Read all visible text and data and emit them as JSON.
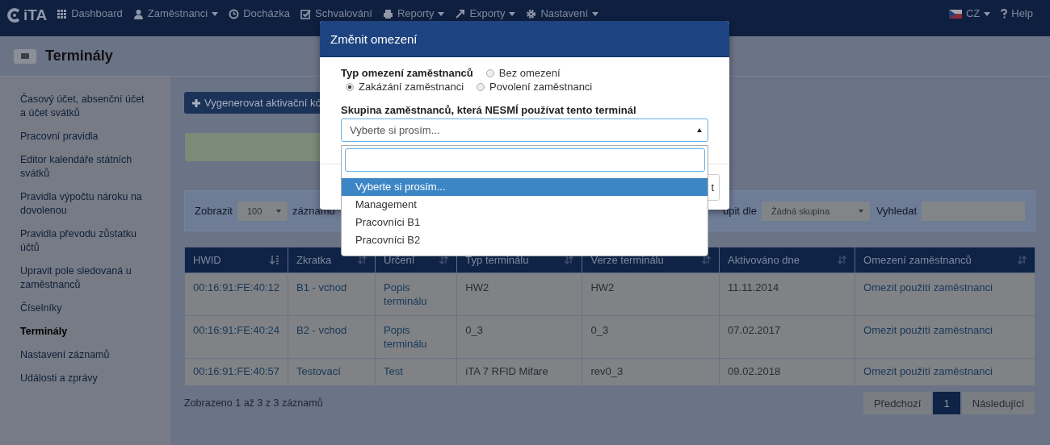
{
  "nav": {
    "logo": "iTA",
    "items": [
      {
        "label": "Dashboard",
        "caret": false
      },
      {
        "label": "Zaměstnanci",
        "caret": true
      },
      {
        "label": "Docházka",
        "caret": false
      },
      {
        "label": "Schvalování",
        "caret": false
      },
      {
        "label": "Reporty",
        "caret": true
      },
      {
        "label": "Exporty",
        "caret": true
      },
      {
        "label": "Nastavení",
        "caret": true
      }
    ],
    "language": "CZ",
    "help": "Help"
  },
  "page_title": "Terminály",
  "sidebar": {
    "items": [
      {
        "label": "Časový účet, absenční účet a účet svátků",
        "selected": false
      },
      {
        "label": "Pracovní pravidla",
        "selected": false
      },
      {
        "label": "Editor kalendáře státních svátků",
        "selected": false
      },
      {
        "label": "Pravidla výpočtu nároku na dovolenou",
        "selected": false
      },
      {
        "label": "Pravidla převodu zůstatku účtů",
        "selected": false
      },
      {
        "label": "Upravit pole sledovaná u zaměstnanců",
        "selected": false
      },
      {
        "label": "Číselníky",
        "selected": false
      },
      {
        "label": "Terminály",
        "selected": true
      },
      {
        "label": "Nastavení záznamů",
        "selected": false
      },
      {
        "label": "Události a zprávy",
        "selected": false
      }
    ]
  },
  "generate_button": "Vygenerovat aktivační kó",
  "filters": {
    "show_label": "Zobrazit",
    "page_size": "100",
    "records_label": "záznamu",
    "group_label": "upit dle",
    "group_value": "Žádná skupina",
    "search_label": "Vyhledat"
  },
  "table": {
    "columns": [
      {
        "label": "HWID",
        "sorted": true,
        "link": true
      },
      {
        "label": "Zkratka",
        "sorted": false,
        "link": true
      },
      {
        "label": "Určení",
        "sorted": false,
        "link": true
      },
      {
        "label": "Typ terminálu",
        "sorted": false,
        "link": false
      },
      {
        "label": "Verze terminálu",
        "sorted": false,
        "link": false
      },
      {
        "label": "Aktivováno dne",
        "sorted": false,
        "link": false
      },
      {
        "label": "Omezení zaměstnanců",
        "sorted": false,
        "link": true
      }
    ],
    "rows": [
      [
        "00:16:91:FE:40:12",
        "B1 - vchod",
        "Popis terminálu",
        "HW2",
        "HW2",
        "11.11.2014",
        "Omezit použití zaměstnanci"
      ],
      [
        "00:16:91:FE:40:24",
        "B2 - vchod",
        "Popis terminálu",
        "0_3",
        "0_3",
        "07.02.2017",
        "Omezit použití zaměstnanci"
      ],
      [
        "00:16:91:FE:40:57",
        "Testovací",
        "Test",
        "iTA 7 RFID Mifare",
        "rev0_3",
        "09.02.2018",
        "Omezit použití zaměstnanci"
      ]
    ]
  },
  "summary": "Zobrazeno 1 až 3 z 3 záznamů",
  "pagination": {
    "previous": "Předchozí",
    "pages": [
      {
        "label": "1",
        "selected": true
      }
    ],
    "next": "Následující"
  },
  "modal": {
    "title": "Změnit omezení",
    "type_label": "Typ omezení zaměstnanců",
    "options": [
      {
        "label": "Bez omezení",
        "selected": false
      },
      {
        "label": "Zakázání zaměstnanci",
        "selected": true
      },
      {
        "label": "Povolení zaměstnanci",
        "selected": false
      }
    ],
    "group_label": "Skupina zaměstnanců, která NESMÍ používat tento terminál",
    "select_value": "Vyberte si prosím...",
    "footer_button": "t",
    "dropdown": {
      "options": [
        {
          "label": "Vyberte si prosím...",
          "selected": true
        },
        {
          "label": "Management",
          "selected": false
        },
        {
          "label": "Pracovníci B1",
          "selected": false
        },
        {
          "label": "Pracovníci B2",
          "selected": false
        }
      ]
    }
  }
}
